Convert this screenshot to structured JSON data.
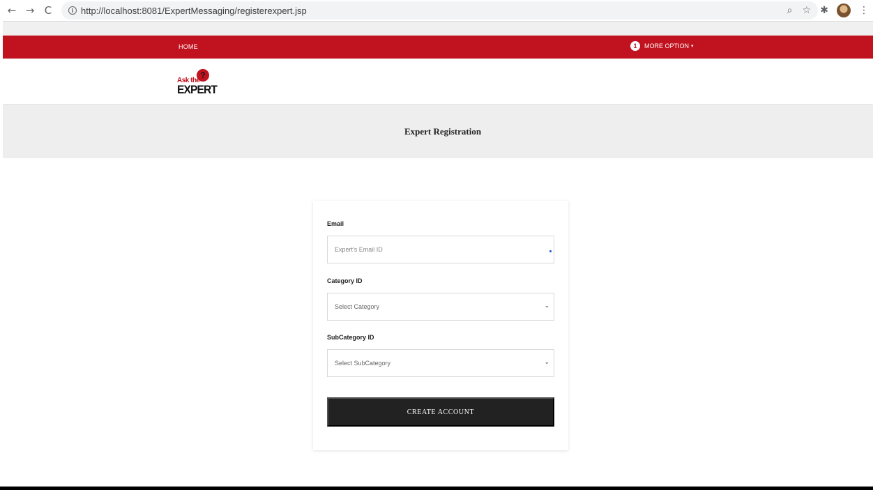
{
  "browser": {
    "back_icon": "←",
    "forward_icon": "→",
    "reload_icon": "C",
    "info_icon": "i",
    "url": "http://localhost:8081/ExpertMessaging/registerexpert.jsp",
    "zoom_icon": "⌕",
    "star_icon": "☆",
    "extensions_icon": "✱",
    "menu_icon": "⋮"
  },
  "navbar": {
    "home_label": "HOME",
    "more_option_label": "MORE OPTION",
    "user_icon_glyph": "1",
    "caret": "▾",
    "accent_color": "#c1121f"
  },
  "logo": {
    "ask_text": "Ask the",
    "bubble_glyph": "?",
    "expert_text": "EXPERT"
  },
  "banner": {
    "title": "Expert Registration"
  },
  "form": {
    "email_label": "Email",
    "email_placeholder": "Expert's Email ID",
    "category_label": "Category ID",
    "category_selected": "Select Category",
    "subcategory_label": "SubCategory ID",
    "subcategory_selected": "Select SubCategory",
    "select_arrow": "⌄",
    "submit_label": "CREATE ACCOUNT"
  }
}
